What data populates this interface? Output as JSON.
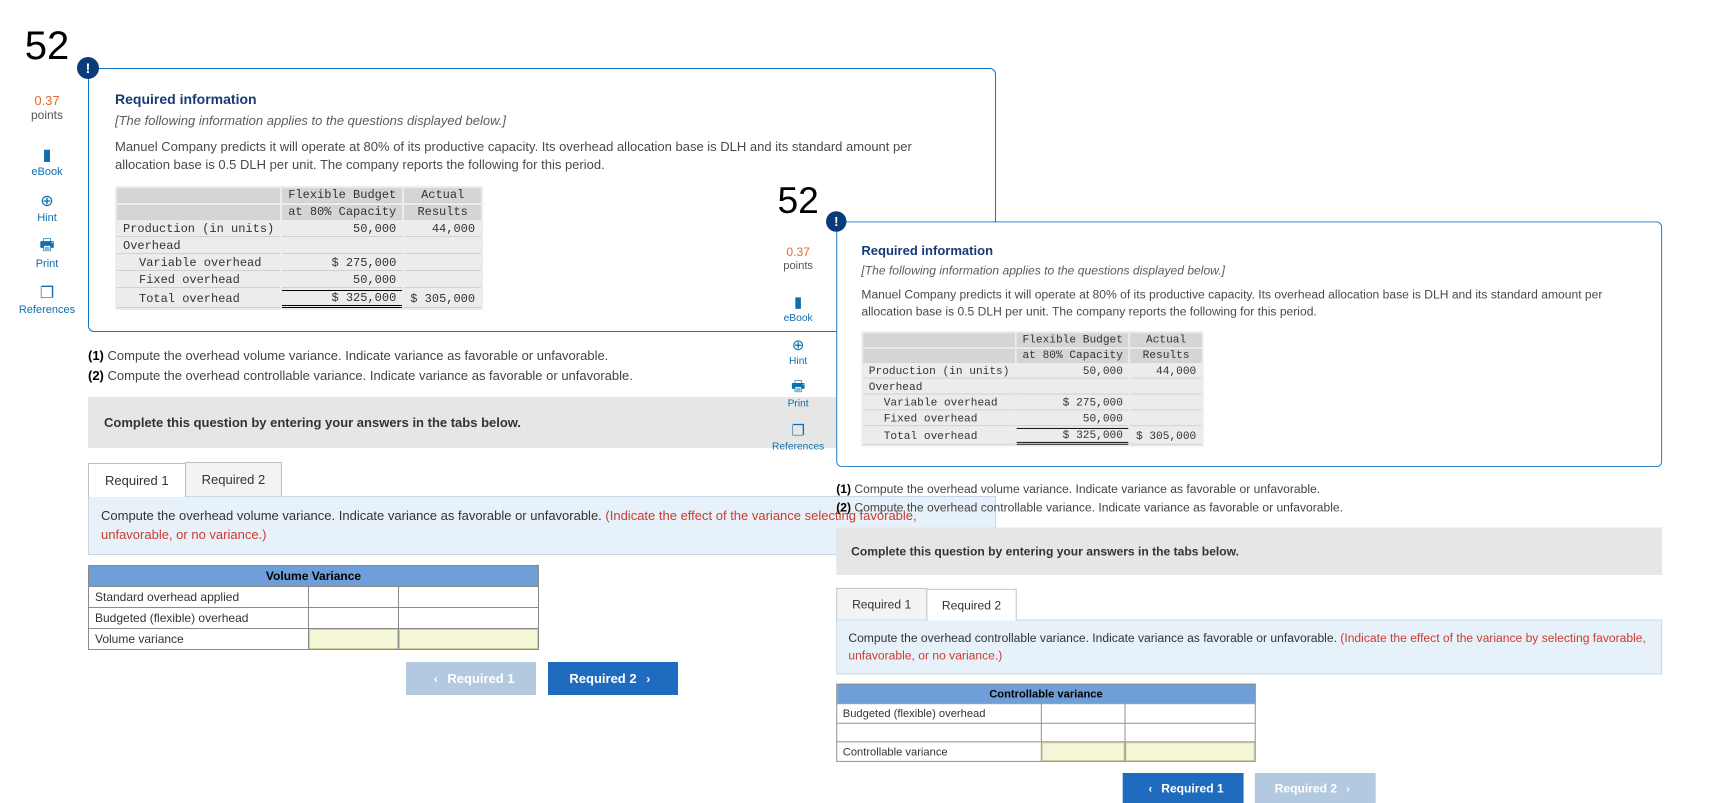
{
  "left": {
    "sidebar": {
      "qnum": "52",
      "points_value": "0.37",
      "points_label": "points",
      "items": {
        "ebook": "eBook",
        "hint": "Hint",
        "print": "Print",
        "references": "References"
      }
    },
    "card": {
      "heading": "Required information",
      "intro_note": "[The following information applies to the questions displayed below.]",
      "body": "Manuel Company predicts it will operate at 80% of its productive capacity. Its overhead allocation base is DLH and its standard amount per allocation base is 0.5 DLH per unit. The company reports the following for this period.",
      "table": {
        "col1": "Flexible Budget",
        "col1b": "at 80% Capacity",
        "col2": "Actual",
        "col2b": "Results",
        "r_prod": "Production (in units)",
        "v_prod_a": "50,000",
        "v_prod_b": "44,000",
        "r_oh": "Overhead",
        "r_var": "Variable overhead",
        "v_var_a": "$ 275,000",
        "r_fix": "Fixed overhead",
        "v_fix_a": "50,000",
        "r_tot": "Total overhead",
        "v_tot_a": "$ 325,000",
        "v_tot_b": "$ 305,000"
      }
    },
    "req1_num": "(1)",
    "req1_txt": " Compute the overhead volume variance. Indicate variance as favorable or unfavorable.",
    "req2_num": "(2)",
    "req2_txt": " Compute the overhead controllable variance. Indicate variance as favorable or unfavorable.",
    "graybox": "Complete this question by entering your answers in the tabs below.",
    "tabs": {
      "a": "Required 1",
      "b": "Required 2"
    },
    "prompt": {
      "main": "Compute the overhead volume variance. Indicate variance as favorable or unfavorable. ",
      "red": "(Indicate the effect of the variance selecting favorable, unfavorable, or no variance.)"
    },
    "ans": {
      "title": "Volume Variance",
      "r1": "Standard overhead applied",
      "r2": "Budgeted (flexible) overhead",
      "r3": "Volume variance"
    },
    "nav": {
      "prev": "Required 1",
      "next": "Required 2"
    }
  },
  "right": {
    "sidebar": {
      "qnum": "52",
      "points_value": "0.37",
      "points_label": "points",
      "items": {
        "ebook": "eBook",
        "hint": "Hint",
        "print": "Print",
        "references": "References"
      }
    },
    "card": {
      "heading": "Required information",
      "intro_note": "[The following information applies to the questions displayed below.]",
      "body": "Manuel Company predicts it will operate at 80% of its productive capacity. Its overhead allocation base is DLH and its standard amount per allocation base is 0.5 DLH per unit. The company reports the following for this period.",
      "table": {
        "col1": "Flexible Budget",
        "col1b": "at 80% Capacity",
        "col2": "Actual",
        "col2b": "Results",
        "r_prod": "Production (in units)",
        "v_prod_a": "50,000",
        "v_prod_b": "44,000",
        "r_oh": "Overhead",
        "r_var": "Variable overhead",
        "v_var_a": "$ 275,000",
        "r_fix": "Fixed overhead",
        "v_fix_a": "50,000",
        "r_tot": "Total overhead",
        "v_tot_a": "$ 325,000",
        "v_tot_b": "$ 305,000"
      }
    },
    "req1_num": "(1)",
    "req1_txt": " Compute the overhead volume variance. Indicate variance as favorable or unfavorable.",
    "req2_num": "(2)",
    "req2_txt": " Compute the overhead controllable variance. Indicate variance as favorable or unfavorable.",
    "graybox": "Complete this question by entering your answers in the tabs below.",
    "tabs": {
      "a": "Required 1",
      "b": "Required 2"
    },
    "prompt": {
      "main": "Compute the overhead controllable variance. Indicate variance as favorable or unfavorable. ",
      "red": "(Indicate the effect of the variance by selecting favorable, unfavorable, or no variance.)"
    },
    "ans": {
      "title": "Controllable variance",
      "r1": "Budgeted (flexible) overhead",
      "r2": "",
      "r3": "Controllable variance"
    },
    "nav": {
      "prev": "Required 1",
      "next": "Required 2"
    }
  }
}
